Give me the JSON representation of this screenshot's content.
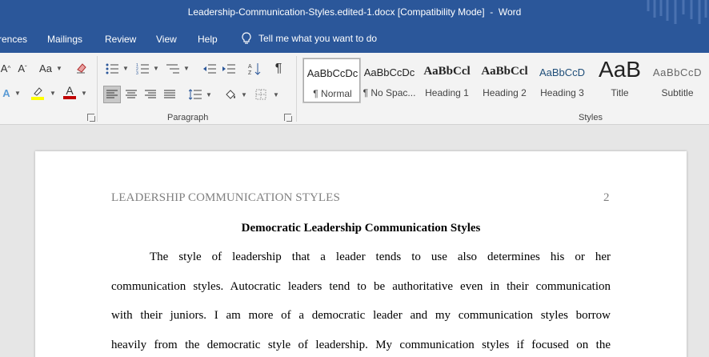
{
  "window": {
    "title": "Leadership-Communication-Styles.edited-1.docx [Compatibility Mode]  -  Word"
  },
  "menu": {
    "tabs": [
      "rences",
      "Mailings",
      "Review",
      "View",
      "Help"
    ],
    "tell_me": "Tell me what you want to do"
  },
  "ribbon": {
    "font_row1": {
      "grow_font": "A",
      "shrink_font": "A",
      "change_case": "Aa"
    },
    "font_row2": {
      "text_effects": "A",
      "font_color": "A"
    },
    "paragraph_label": "Paragraph",
    "styles_label": "Styles",
    "styles": [
      {
        "sample": "AaBbCcDc",
        "name": "¶ Normal"
      },
      {
        "sample": "AaBbCcDc",
        "name": "¶ No Spac..."
      },
      {
        "sample": "AaBbCcl",
        "name": "Heading 1"
      },
      {
        "sample": "AaBbCcl",
        "name": "Heading 2"
      },
      {
        "sample": "AaBbCcD",
        "name": "Heading 3"
      },
      {
        "sample": "AaB",
        "name": "Title"
      },
      {
        "sample": "AaBbCcD",
        "name": "Subtitle"
      }
    ],
    "accent_colors": {
      "highlight": "#ffff00",
      "font_color": "#c00000"
    }
  },
  "document": {
    "header": "LEADERSHIP COMMUNICATION STYLES",
    "page_number": "2",
    "heading": "Democratic Leadership Communication Styles",
    "lines": [
      "The style of leadership that a leader tends to use also determines his or her",
      "communication styles. Autocratic leaders tend to be authoritative even in their communication",
      "with their juniors. I am more of a democratic leader and my communication styles borrow",
      "heavily from the democratic style of leadership.  My communication styles if focused on the"
    ]
  }
}
